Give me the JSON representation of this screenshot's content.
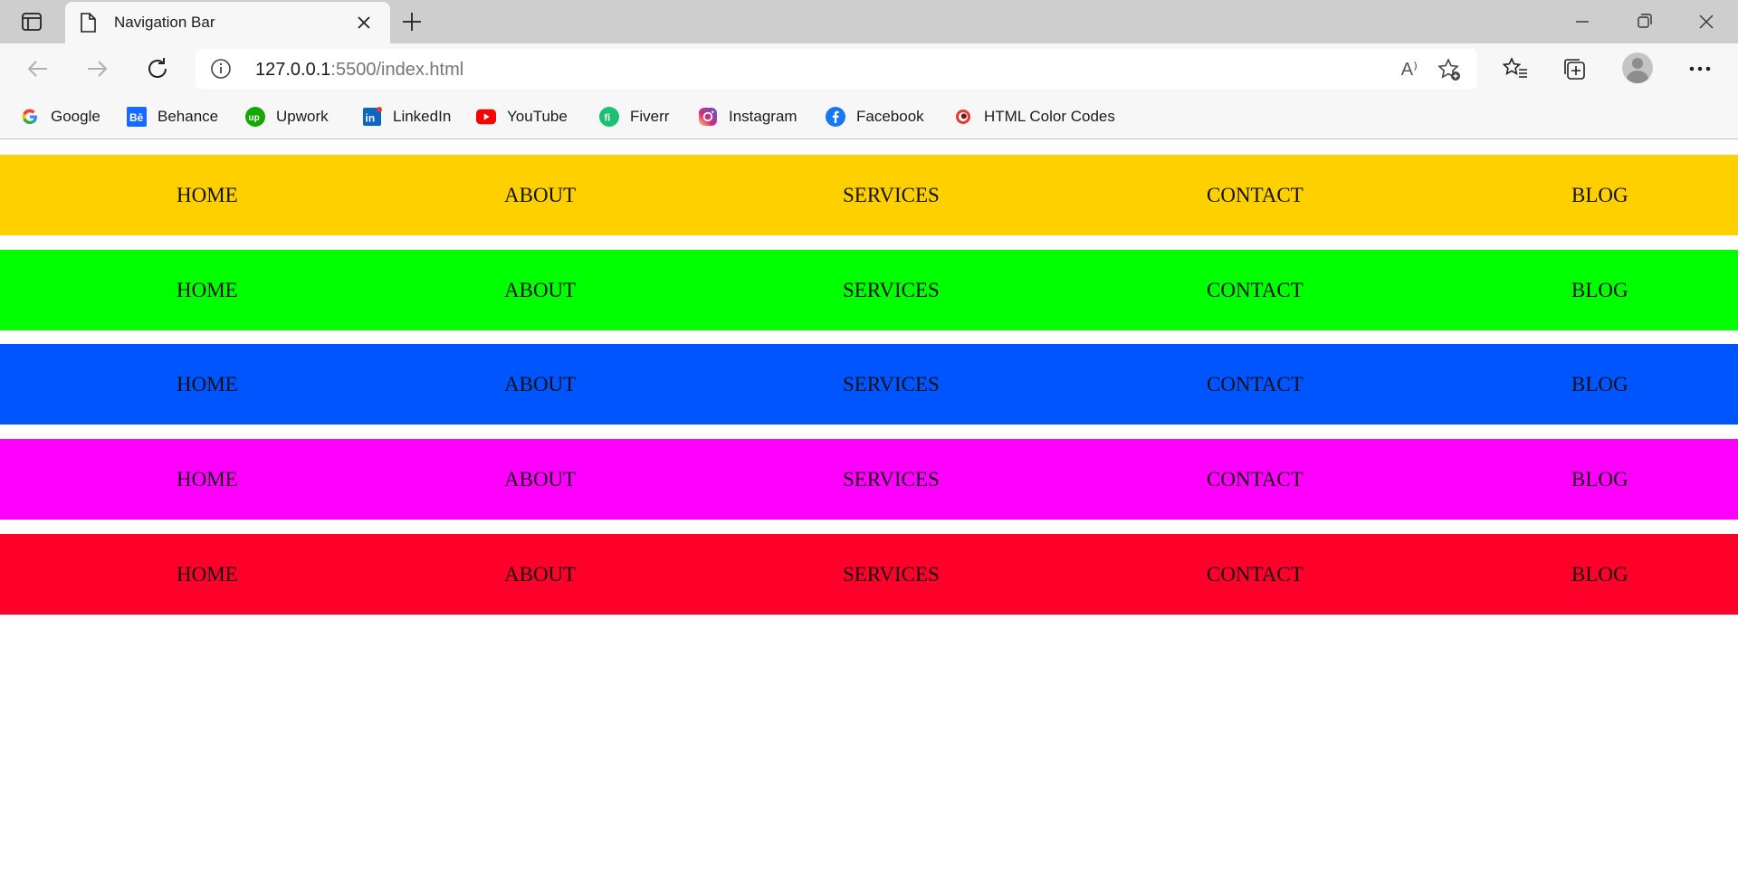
{
  "browser": {
    "tab_title": "Navigation Bar",
    "url_host": "127.0.0.1",
    "url_rest": ":5500/index.html",
    "read_aloud_label": "A⁾"
  },
  "bookmarks": [
    {
      "label": "Google",
      "icon": "google-icon"
    },
    {
      "label": "Behance",
      "icon": "behance-icon"
    },
    {
      "label": "Upwork",
      "icon": "upwork-icon"
    },
    {
      "label": "LinkedIn",
      "icon": "linkedin-icon"
    },
    {
      "label": "YouTube",
      "icon": "youtube-icon"
    },
    {
      "label": "Fiverr",
      "icon": "fiverr-icon"
    },
    {
      "label": "Instagram",
      "icon": "instagram-icon"
    },
    {
      "label": "Facebook",
      "icon": "facebook-icon"
    },
    {
      "label": "HTML Color Codes",
      "icon": "html-color-codes-icon"
    }
  ],
  "navbars": [
    {
      "color": "#ffd000",
      "links": [
        "HOME",
        "ABOUT",
        "SERVICES",
        "CONTACT",
        "BLOG"
      ]
    },
    {
      "color": "#00ff00",
      "links": [
        "HOME",
        "ABOUT",
        "SERVICES",
        "CONTACT",
        "BLOG"
      ]
    },
    {
      "color": "#0055ff",
      "links": [
        "HOME",
        "ABOUT",
        "SERVICES",
        "CONTACT",
        "BLOG"
      ]
    },
    {
      "color": "#ff00ff",
      "links": [
        "HOME",
        "ABOUT",
        "SERVICES",
        "CONTACT",
        "BLOG"
      ]
    },
    {
      "color": "#ff002b",
      "links": [
        "HOME",
        "ABOUT",
        "SERVICES",
        "CONTACT",
        "BLOG"
      ]
    }
  ]
}
